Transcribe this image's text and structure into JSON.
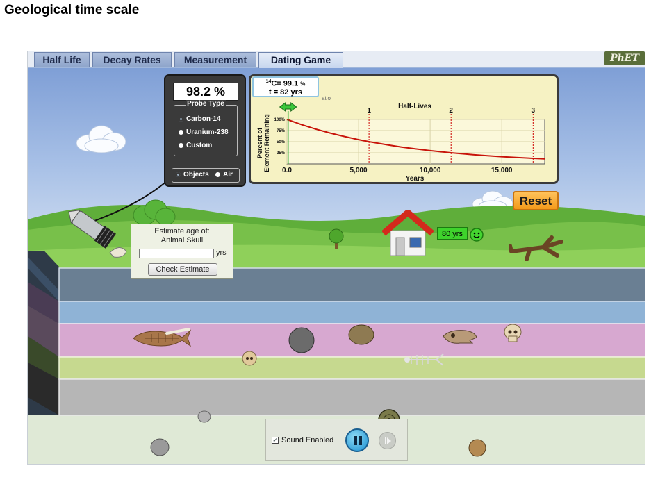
{
  "slide": {
    "title": "Geological time scale"
  },
  "tabs": [
    {
      "label": "Half Life"
    },
    {
      "label": "Decay Rates"
    },
    {
      "label": "Measurement"
    },
    {
      "label": "Dating Game",
      "active": true
    }
  ],
  "logo": {
    "text": "PhET"
  },
  "probe_panel": {
    "readout": "98.2 %",
    "probe_type_title": "Probe Type",
    "options": [
      "Carbon-14",
      "Uranium-238",
      "Custom"
    ],
    "selected_option": "Carbon-14",
    "modes": [
      "Objects",
      "Air"
    ],
    "selected_mode": "Objects"
  },
  "graph_readout": {
    "element_superscript": "14",
    "element": "C= 99.1",
    "percent_symbol": "%",
    "time": "t = 82 yrs",
    "obscured_text": "atio"
  },
  "reset": {
    "label": "Reset"
  },
  "estimate": {
    "title_line1": "Estimate age of:",
    "title_line2": "Animal Skull",
    "input_value": "",
    "unit": "yrs",
    "button_label": "Check Estimate"
  },
  "house_badge": {
    "label": "80 yrs"
  },
  "controls": {
    "sound_label": "Sound Enabled",
    "sound_enabled": true
  },
  "chart_data": {
    "type": "line",
    "title": "Half-Lives",
    "xlabel": "Years",
    "ylabel": "Percent of Element Remaining",
    "xlim": [
      0,
      18000
    ],
    "ylim": [
      0,
      100
    ],
    "x_ticks": [
      "0.0",
      "5,000",
      "10,000",
      "15,000"
    ],
    "x_tick_values": [
      0,
      5000,
      10000,
      15000
    ],
    "y_ticks": [
      "100%",
      "75%",
      "50%",
      "25%"
    ],
    "y_tick_values": [
      100,
      75,
      50,
      25
    ],
    "half_life_years": 5730,
    "half_life_markers": [
      {
        "label": "1",
        "x": 5730
      },
      {
        "label": "2",
        "x": 11460
      },
      {
        "label": "3",
        "x": 17190
      }
    ],
    "series": [
      {
        "x": [
          0,
          1000,
          2000,
          3000,
          4000,
          5000,
          5730,
          7000,
          8000,
          9000,
          10000,
          11460,
          13000,
          14000,
          15000,
          16000,
          17190,
          18000
        ],
        "y": [
          100,
          88.6,
          78.5,
          69.6,
          61.7,
          54.6,
          50,
          42.9,
          38.0,
          33.7,
          29.8,
          25,
          20.7,
          18.4,
          16.3,
          14.4,
          12.5,
          11.3
        ]
      }
    ],
    "current_marker": {
      "x": 82
    },
    "line_color": "#c8140a",
    "marker_line_color": "#cc0000",
    "grid": true
  }
}
